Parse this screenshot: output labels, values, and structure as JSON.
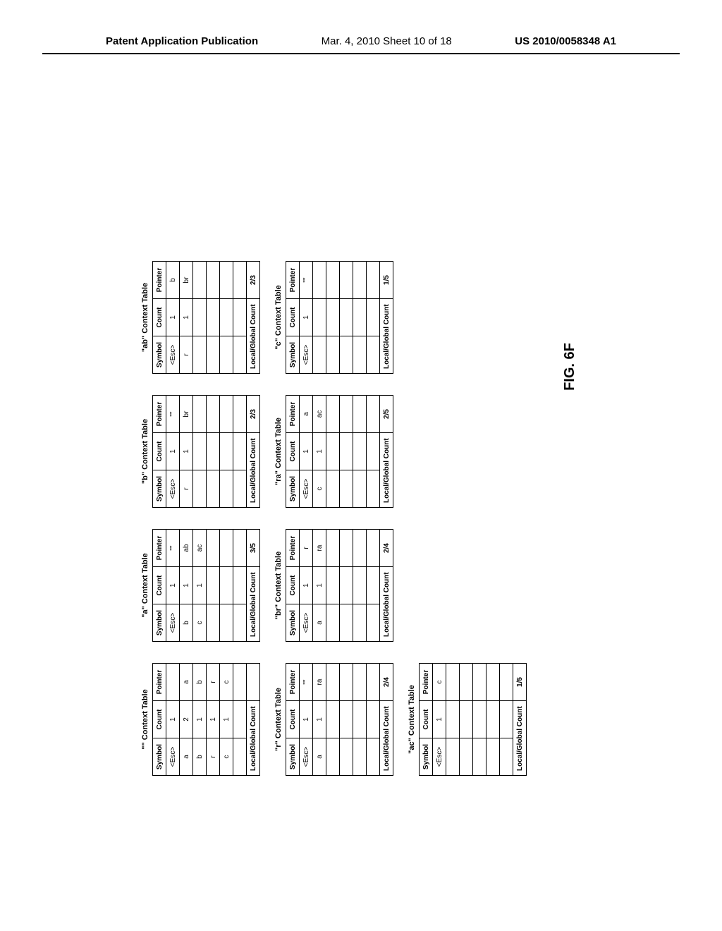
{
  "header": {
    "left": "Patent Application Publication",
    "center": "Mar. 4, 2010  Sheet 10 of 18",
    "right": "US 2010/0058348 A1"
  },
  "figureLabel": "FIG. 6F",
  "columns": [
    "Symbol",
    "Count",
    "Pointer"
  ],
  "footerLabel": "Local/Global Count",
  "tables": [
    {
      "title": "\"\" Context Table",
      "rows": [
        [
          "<Esc>",
          "1",
          ""
        ],
        [
          "a",
          "2",
          "a"
        ],
        [
          "b",
          "1",
          "b"
        ],
        [
          "r",
          "1",
          "r"
        ],
        [
          "c",
          "1",
          "c"
        ],
        [
          "",
          "",
          ""
        ]
      ],
      "footer": ""
    },
    {
      "title": "\"a\" Context Table",
      "rows": [
        [
          "<Esc>",
          "1",
          "\"\""
        ],
        [
          "b",
          "1",
          "ab"
        ],
        [
          "c",
          "1",
          "ac"
        ],
        [
          "",
          "",
          ""
        ],
        [
          "",
          "",
          ""
        ],
        [
          "",
          "",
          ""
        ]
      ],
      "footer": "3/5"
    },
    {
      "title": "\"b\" Context Table",
      "rows": [
        [
          "<Esc>",
          "1",
          "\"\""
        ],
        [
          "r",
          "1",
          "br"
        ],
        [
          "",
          "",
          ""
        ],
        [
          "",
          "",
          ""
        ],
        [
          "",
          "",
          ""
        ],
        [
          "",
          "",
          ""
        ]
      ],
      "footer": "2/3"
    },
    {
      "title": "\"ab\" Context Table",
      "rows": [
        [
          "<Esc>",
          "1",
          "b"
        ],
        [
          "r",
          "1",
          "br"
        ],
        [
          "",
          "",
          ""
        ],
        [
          "",
          "",
          ""
        ],
        [
          "",
          "",
          ""
        ],
        [
          "",
          "",
          ""
        ]
      ],
      "footer": "2/3"
    },
    {
      "title": "\"r\" Context Table",
      "rows": [
        [
          "<Esc>",
          "1",
          "\"\""
        ],
        [
          "a",
          "1",
          "ra"
        ],
        [
          "",
          "",
          ""
        ],
        [
          "",
          "",
          ""
        ],
        [
          "",
          "",
          ""
        ],
        [
          "",
          "",
          ""
        ]
      ],
      "footer": "2/4"
    },
    {
      "title": "\"br\" Context Table",
      "rows": [
        [
          "<Esc>",
          "1",
          "r"
        ],
        [
          "a",
          "1",
          "ra"
        ],
        [
          "",
          "",
          ""
        ],
        [
          "",
          "",
          ""
        ],
        [
          "",
          "",
          ""
        ],
        [
          "",
          "",
          ""
        ]
      ],
      "footer": "2/4"
    },
    {
      "title": "\"ra\" Context Table",
      "rows": [
        [
          "<Esc>",
          "1",
          "a"
        ],
        [
          "c",
          "1",
          "ac"
        ],
        [
          "",
          "",
          ""
        ],
        [
          "",
          "",
          ""
        ],
        [
          "",
          "",
          ""
        ],
        [
          "",
          "",
          ""
        ]
      ],
      "footer": "2/5"
    },
    {
      "title": "\"c\" Context Table",
      "rows": [
        [
          "<Esc>",
          "1",
          "\"\""
        ],
        [
          "",
          "",
          ""
        ],
        [
          "",
          "",
          ""
        ],
        [
          "",
          "",
          ""
        ],
        [
          "",
          "",
          ""
        ],
        [
          "",
          "",
          ""
        ]
      ],
      "footer": "1/5"
    },
    {
      "title": "\"ac\" Context Table",
      "rows": [
        [
          "<Esc>",
          "1",
          "c"
        ],
        [
          "",
          "",
          ""
        ],
        [
          "",
          "",
          ""
        ],
        [
          "",
          "",
          ""
        ],
        [
          "",
          "",
          ""
        ],
        [
          "",
          "",
          ""
        ]
      ],
      "footer": "1/5"
    }
  ],
  "layout": [
    [
      0,
      1,
      2,
      3
    ],
    [
      4,
      5,
      6,
      7
    ],
    [
      8
    ]
  ]
}
